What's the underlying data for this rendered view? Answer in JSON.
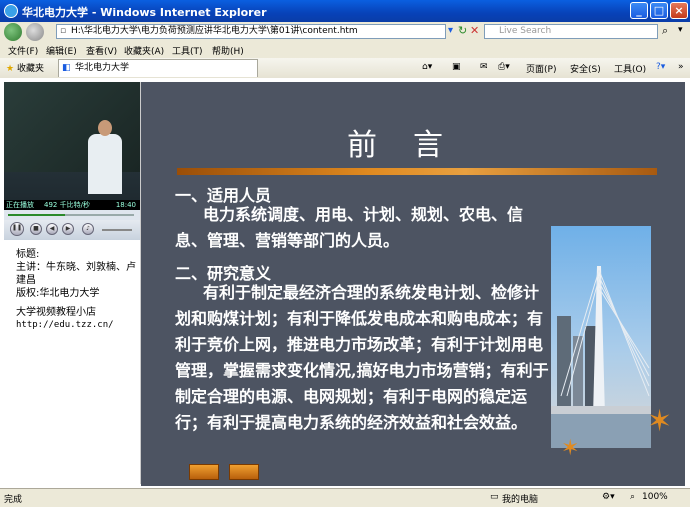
{
  "window": {
    "title": "华北电力大学 - Windows Internet Explorer"
  },
  "address": {
    "url": "H:\\华北电力大学\\电力负荷预测应讲华北电力大学\\第01讲\\content.htm",
    "search_placeholder": "Live Search"
  },
  "menu": [
    "文件(F)",
    "编辑(E)",
    "查看(V)",
    "收藏夹(A)",
    "工具(T)",
    "帮助(H)"
  ],
  "favorites": {
    "label": "收藏夹",
    "tab_title": "华北电力大学"
  },
  "toolbar": {
    "page": "页面(P)",
    "safety": "安全(S)",
    "tools": "工具(O)"
  },
  "player": {
    "status": "正在播放",
    "bitrate": "492 千比特/秒",
    "time": "18:40",
    "progress_fraction": 0.45
  },
  "info": {
    "title_label": "标题:",
    "lecturer": "主讲：牛东晓、刘敦楠、卢建昌",
    "copyright": "版权:华北电力大学",
    "shop": "大学视频教程小店",
    "site": "http://edu.tzz.cn/"
  },
  "slide": {
    "heading": "前言",
    "section1_title": "一、适用人员",
    "section1_body": "电力系统调度、用电、计划、规划、农电、信息、管理、营销等部门的人员。",
    "section2_title": "二、研究意义",
    "section2_body": "有利于制定最经济合理的系统发电计划、检修计划和购煤计划；有利于降低发电成本和购电成本；有利于竞价上网，推进电力市场改革；有利于计划用电管理，掌握需求变化情况,搞好电力市场营销；有利于制定合理的电源、电网规划；有利于电网的稳定运行；有利于提高电力系统的经济效益和社会效益。"
  },
  "status": {
    "left": "完成",
    "zone": "我的电脑",
    "zoom": "100%"
  },
  "colors": {
    "titlebar": "#0A55D8",
    "slide_bg": "#4D5462",
    "accent_orange": "#E08A20"
  }
}
